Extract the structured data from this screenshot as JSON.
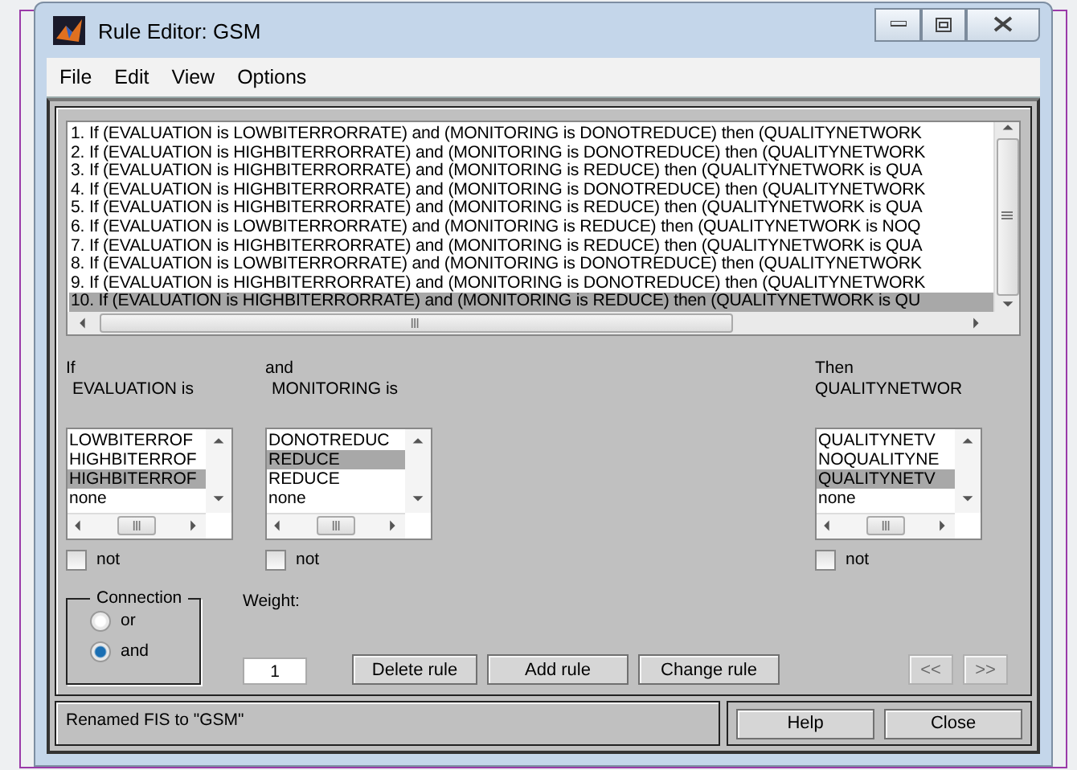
{
  "window": {
    "title": "Rule Editor: GSM"
  },
  "menu": [
    "File",
    "Edit",
    "View",
    "Options"
  ],
  "rules": [
    {
      "text": "1. If (EVALUATION is LOWBITERRORRATE) and (MONITORING is DONOTREDUCE) then (QUALITYNETWORK",
      "selected": false
    },
    {
      "text": "2. If (EVALUATION is HIGHBITERRORRATE) and (MONITORING is DONOTREDUCE) then (QUALITYNETWORK",
      "selected": false
    },
    {
      "text": "3. If (EVALUATION is HIGHBITERRORRATE) and (MONITORING is REDUCE) then (QUALITYNETWORK is QUA",
      "selected": false
    },
    {
      "text": "4. If (EVALUATION is HIGHBITERRORRATE) and (MONITORING is DONOTREDUCE) then (QUALITYNETWORK",
      "selected": false
    },
    {
      "text": "5. If (EVALUATION is HIGHBITERRORRATE) and (MONITORING is REDUCE) then (QUALITYNETWORK is QUA",
      "selected": false
    },
    {
      "text": "6. If (EVALUATION is LOWBITERRORRATE) and (MONITORING is REDUCE) then (QUALITYNETWORK is NOQ",
      "selected": false
    },
    {
      "text": "7. If (EVALUATION is HIGHBITERRORRATE) and (MONITORING is REDUCE) then (QUALITYNETWORK is QUA",
      "selected": false
    },
    {
      "text": "8. If (EVALUATION is LOWBITERRORRATE) and (MONITORING is DONOTREDUCE) then (QUALITYNETWORK",
      "selected": false
    },
    {
      "text": "9. If (EVALUATION is HIGHBITERRORRATE) and (MONITORING is DONOTREDUCE) then (QUALITYNETWORK",
      "selected": false
    },
    {
      "text": "10. If (EVALUATION is HIGHBITERRORRATE) and (MONITORING is REDUCE) then (QUALITYNETWORK is QU",
      "selected": true
    }
  ],
  "selectors": [
    {
      "header": "If",
      "variable": "EVALUATION is",
      "items": [
        {
          "label": "LOWBITERROF",
          "selected": false
        },
        {
          "label": "HIGHBITERROF",
          "selected": false
        },
        {
          "label": "HIGHBITERROF",
          "selected": true
        },
        {
          "label": "none",
          "selected": false
        }
      ],
      "not_label": "not",
      "not_checked": false
    },
    {
      "header": "and",
      "variable": "MONITORING is",
      "items": [
        {
          "label": "DONOTREDUC",
          "selected": false
        },
        {
          "label": "REDUCE",
          "selected": true
        },
        {
          "label": "REDUCE",
          "selected": false
        },
        {
          "label": "none",
          "selected": false
        }
      ],
      "not_label": "not",
      "not_checked": false
    },
    {
      "header": "Then",
      "variable": "QUALITYNETWOR",
      "items": [
        {
          "label": "QUALITYNETV",
          "selected": false
        },
        {
          "label": "NOQUALITYNE",
          "selected": false
        },
        {
          "label": "QUALITYNETV",
          "selected": true
        },
        {
          "label": "none",
          "selected": false
        }
      ],
      "not_label": "not",
      "not_checked": false
    }
  ],
  "connection": {
    "label": "Connection",
    "options": [
      {
        "label": "or",
        "selected": false
      },
      {
        "label": "and",
        "selected": true
      }
    ]
  },
  "weight": {
    "label": "Weight:",
    "value": "1"
  },
  "rule_buttons": [
    {
      "label": "Delete rule",
      "disabled": false
    },
    {
      "label": "Add rule",
      "disabled": false
    },
    {
      "label": "Change rule",
      "disabled": false
    }
  ],
  "nav_buttons": [
    {
      "label": "<<",
      "disabled": true
    },
    {
      "label": ">>",
      "disabled": true
    }
  ],
  "status": "Renamed FIS to \"GSM\"",
  "footer_buttons": [
    "Help",
    "Close"
  ]
}
